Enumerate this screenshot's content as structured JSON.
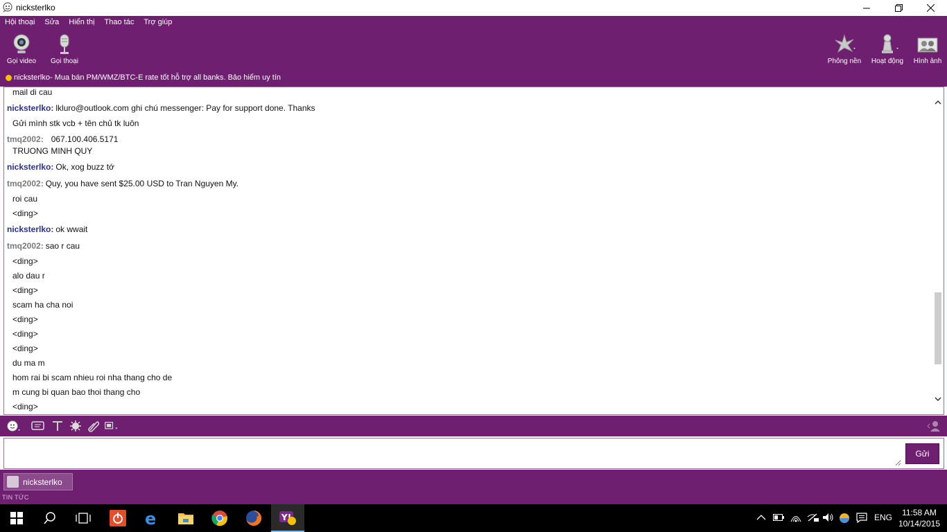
{
  "window": {
    "title": "nicksterlko"
  },
  "menu": [
    "Hội thoại",
    "Sửa",
    "Hiển thị",
    "Thao tác",
    "Trợ giúp"
  ],
  "toolbar": {
    "video_call": "Gọi video",
    "voice_call": "Gọi thoại",
    "background": "Phông nền",
    "activity": "Hoạt động",
    "photos": "Hình ảnh"
  },
  "contact_status": {
    "name": "nicksterlko",
    "status_message": " - Mua bán PM/WMZ/BTC-E rate tốt hỗ trợ all banks. Bảo hiểm uy tín"
  },
  "messages": [
    {
      "sender": "",
      "text": "mail di cau"
    },
    {
      "sender": "nicksterlko:",
      "text": "lkluro@outlook.com ghi chú messenger: Pay for support done. Thanks"
    },
    {
      "sender": "",
      "text": "Gửi mình stk vcb + tên chủ tk luôn"
    },
    {
      "sender": "tmq2002:",
      "text": "067.100.406.5171"
    },
    {
      "sender": "",
      "text": "TRUONG MINH QUY"
    },
    {
      "sender": "nicksterlko:",
      "text": "Ok, xog buzz tớ"
    },
    {
      "sender": "tmq2002:",
      "text": "Quy, you have sent $25.00 USD to Tran Nguyen My."
    },
    {
      "sender": "",
      "text": "roi cau"
    },
    {
      "sender": "",
      "text": "<ding>"
    },
    {
      "sender": "nicksterlko:",
      "text": "ok wwait"
    },
    {
      "sender": "tmq2002:",
      "text": "sao r cau"
    },
    {
      "sender": "",
      "text": "<ding>"
    },
    {
      "sender": "",
      "text": "alo dau r"
    },
    {
      "sender": "",
      "text": "<ding>"
    },
    {
      "sender": "",
      "text": "scam ha cha noi"
    },
    {
      "sender": "",
      "text": "<ding>"
    },
    {
      "sender": "",
      "text": "<ding>"
    },
    {
      "sender": "",
      "text": "<ding>"
    },
    {
      "sender": "",
      "text": "du ma m"
    },
    {
      "sender": "",
      "text": "hom rai bi scam nhieu roi nha thang cho de"
    },
    {
      "sender": "",
      "text": "m cung bi quan bao thoi thang cho"
    },
    {
      "sender": "",
      "text": "<ding>"
    }
  ],
  "input": {
    "value": "",
    "send_label": "Gửi"
  },
  "tab": {
    "label": "nicksterlko"
  },
  "news_label": "TIN TỨC",
  "taskbar": {
    "language": "ENG",
    "time": "11:58 AM",
    "date": "10/14/2015"
  },
  "colors": {
    "app_purple": "#6e1f70",
    "sender_self": "#2b2f8a",
    "sender_other": "#7a7a7a"
  }
}
